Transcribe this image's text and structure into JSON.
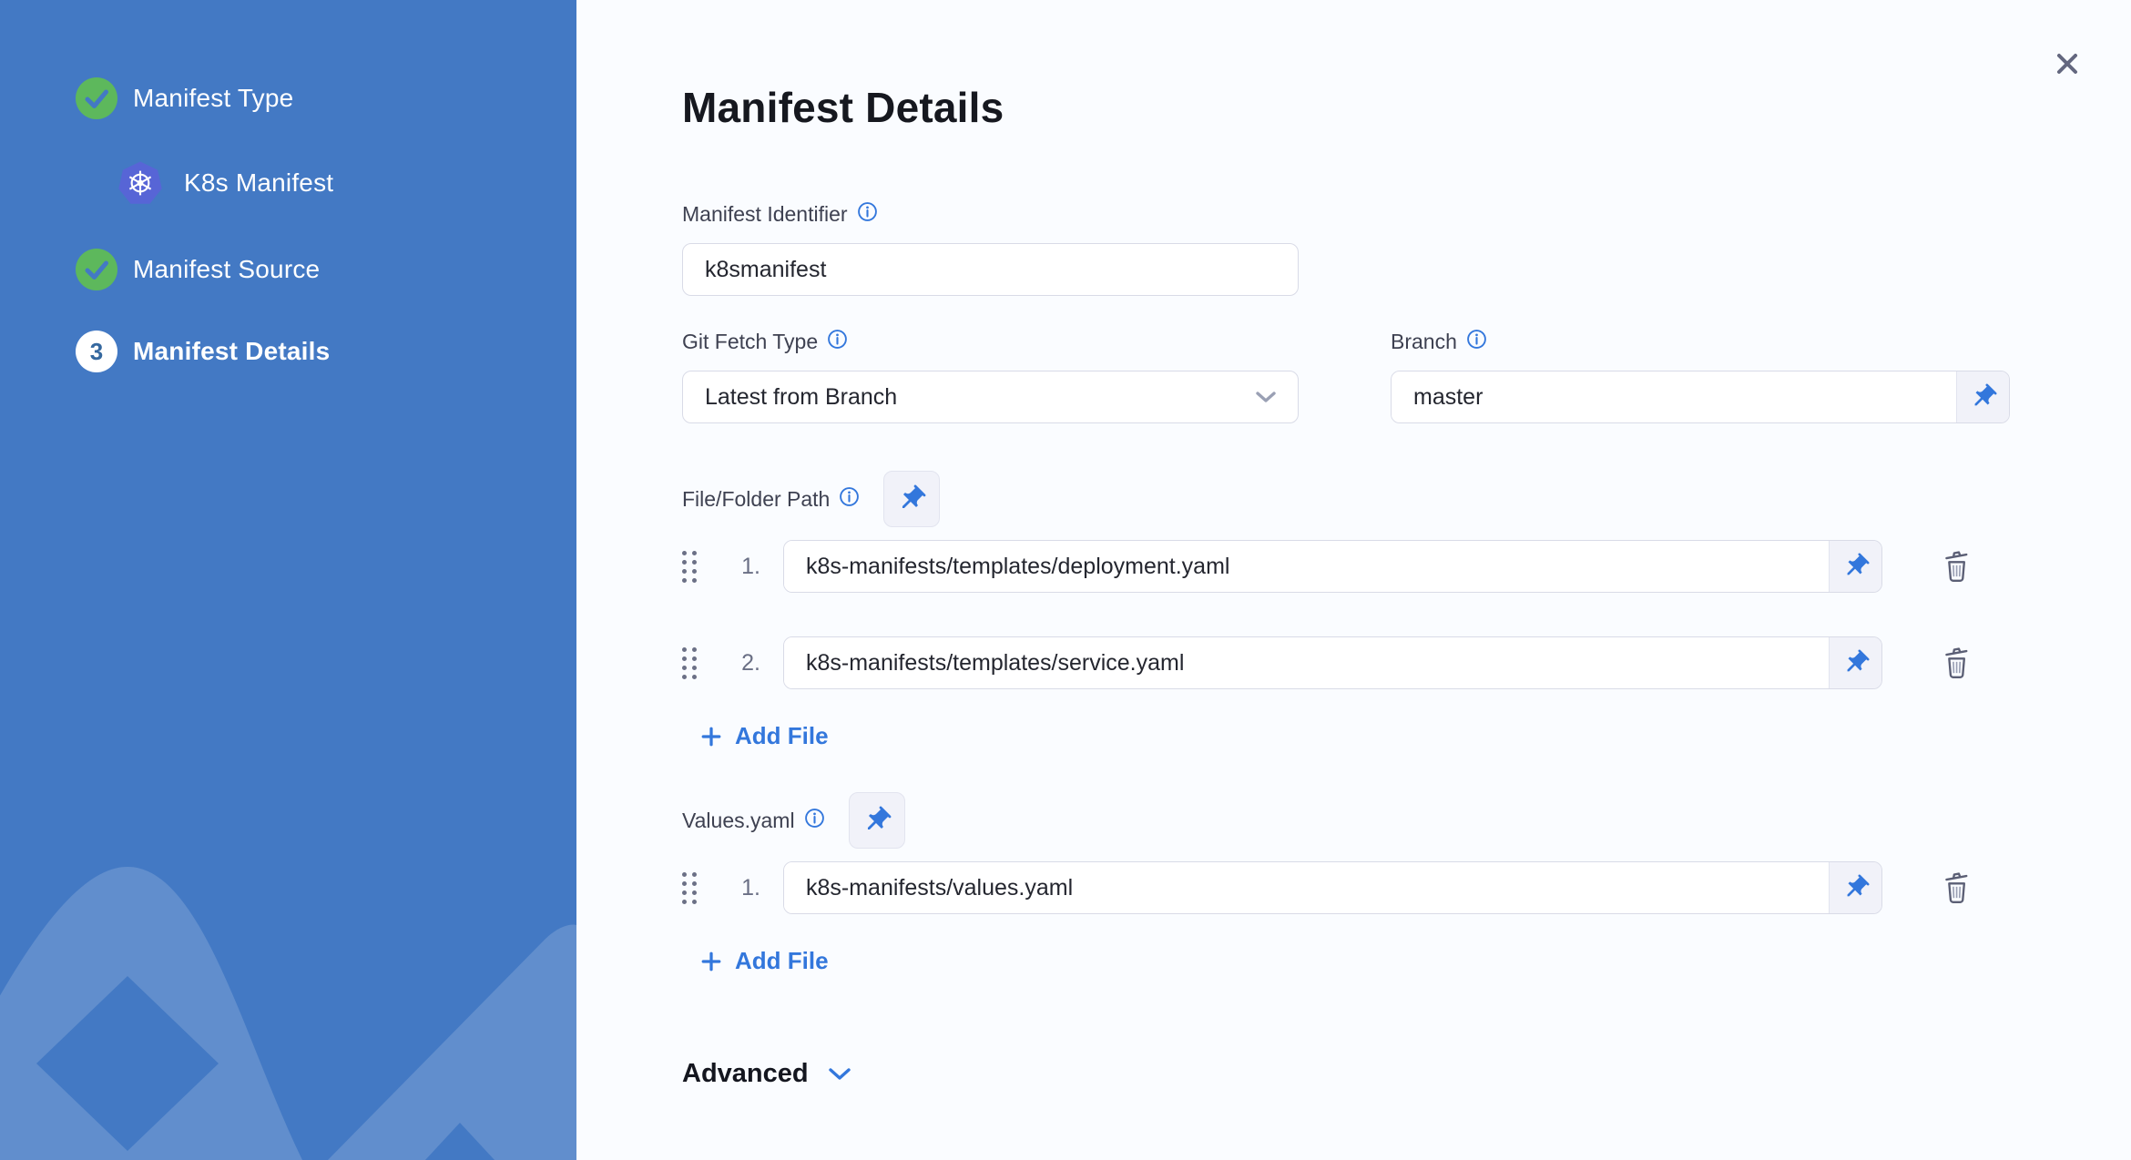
{
  "colors": {
    "sidebar_blue": "#4379C4",
    "accent_blue": "#3377DC",
    "success_green": "#5DB85C",
    "k8s_indigo": "#5765D6",
    "content_bg": "#FAFCFF",
    "input_border": "#D9DBE7"
  },
  "sidebar": {
    "step1_label": "Manifest Type",
    "substep_label": "K8s Manifest",
    "step2_label": "Manifest Source",
    "step3_label": "Manifest Details",
    "step3_number": "3"
  },
  "header": {
    "title": "Manifest Details"
  },
  "form": {
    "identifier": {
      "label": "Manifest Identifier",
      "value": "k8smanifest"
    },
    "git_fetch_type": {
      "label": "Git Fetch Type",
      "value": "Latest from Branch"
    },
    "branch": {
      "label": "Branch",
      "value": "master"
    },
    "paths": {
      "label": "File/Folder Path",
      "rows": [
        {
          "index": "1.",
          "value": "k8s-manifests/templates/deployment.yaml"
        },
        {
          "index": "2.",
          "value": "k8s-manifests/templates/service.yaml"
        }
      ],
      "add_label": "Add File"
    },
    "values_yaml": {
      "label": "Values.yaml",
      "rows": [
        {
          "index": "1.",
          "value": "k8s-manifests/values.yaml"
        }
      ],
      "add_label": "Add File"
    },
    "advanced_label": "Advanced"
  },
  "icons": {
    "check_complete": "check-circle-icon",
    "kubernetes": "kubernetes-icon",
    "info": "info-icon",
    "pin": "pushpin-icon",
    "trash": "trash-icon",
    "drag": "drag-handle-icon",
    "chevron": "chevron-down-icon",
    "plus": "plus-icon",
    "close": "close-icon"
  }
}
